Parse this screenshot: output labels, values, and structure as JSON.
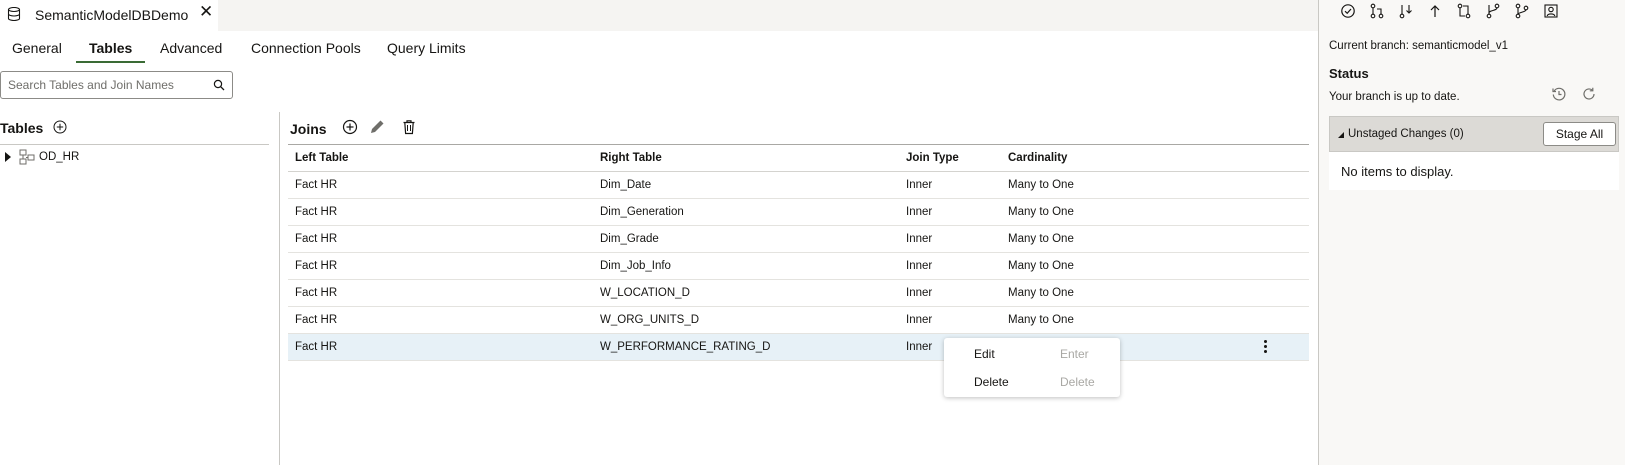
{
  "document_tab": {
    "title": "SemanticModelDBDemo",
    "close_glyph": "✕",
    "icon": "database-icon"
  },
  "sub_tabs": [
    {
      "label": "General"
    },
    {
      "label": "Tables",
      "active": true
    },
    {
      "label": "Advanced"
    },
    {
      "label": "Connection Pools"
    },
    {
      "label": "Query Limits"
    }
  ],
  "search": {
    "placeholder": "Search Tables and Join Names",
    "value": ""
  },
  "tables_pane": {
    "title": "Tables",
    "tree": [
      {
        "label": "OD_HR",
        "expanded": false
      }
    ]
  },
  "joins_pane": {
    "title": "Joins",
    "columns": [
      "Left Table",
      "Right Table",
      "Join Type",
      "Cardinality"
    ],
    "rows": [
      [
        "Fact HR",
        "Dim_Date",
        "Inner",
        "Many to One"
      ],
      [
        "Fact HR",
        "Dim_Generation",
        "Inner",
        "Many to One"
      ],
      [
        "Fact HR",
        "Dim_Grade",
        "Inner",
        "Many to One"
      ],
      [
        "Fact HR",
        "Dim_Job_Info",
        "Inner",
        "Many to One"
      ],
      [
        "Fact HR",
        "W_LOCATION_D",
        "Inner",
        "Many to One"
      ],
      [
        "Fact HR",
        "W_ORG_UNITS_D",
        "Inner",
        "Many to One"
      ],
      [
        "Fact HR",
        "W_PERFORMANCE_RATING_D",
        "Inner",
        ""
      ]
    ],
    "selected_row": 6
  },
  "context_menu": {
    "items": [
      {
        "label": "Edit",
        "shortcut": "Enter"
      },
      {
        "label": "Delete",
        "shortcut": "Delete"
      }
    ]
  },
  "git_panel": {
    "current_branch": "Current branch: semanticmodel_v1",
    "status_title": "Status",
    "status_text": "Your branch is up to date.",
    "unstaged_label": "Unstaged Changes (0)",
    "stage_all_label": "Stage All",
    "empty_text": "No items to display."
  },
  "colors": {
    "accent_underline": "#3a6b35",
    "selected_row": "#e7f1f7",
    "panel_bg": "#f9f8f6",
    "unstaged_bar": "#dcdad6"
  }
}
